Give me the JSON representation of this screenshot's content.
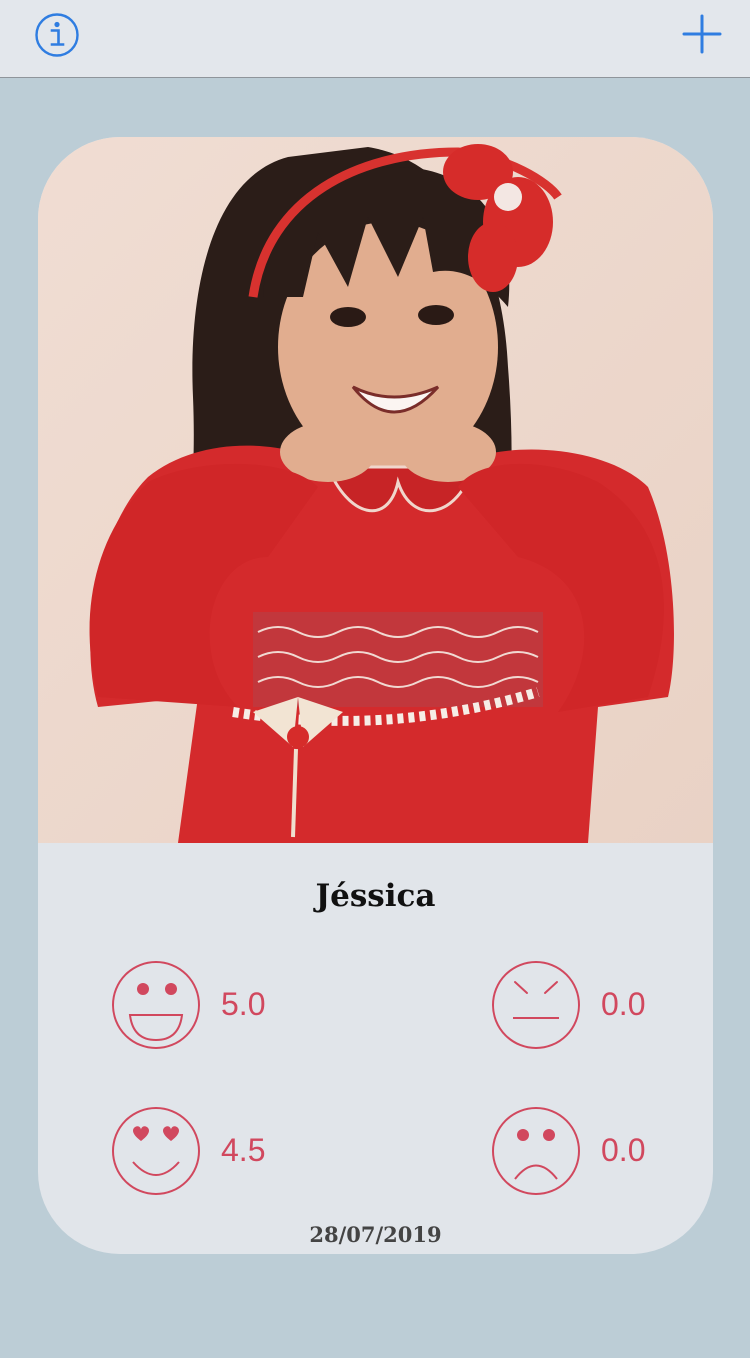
{
  "toolbar": {
    "info_icon": "info-circle-icon",
    "add_icon": "plus-icon"
  },
  "card": {
    "name": "Jéssica",
    "date": "28/07/2019",
    "stats": {
      "happy": "5.0",
      "love": "4.5",
      "angry": "0.0",
      "sad": "0.0"
    }
  },
  "colors": {
    "accent": "#2f7de1",
    "emoji": "#d1485e",
    "background": "#bccdd6",
    "card": "#e1e5ea"
  }
}
